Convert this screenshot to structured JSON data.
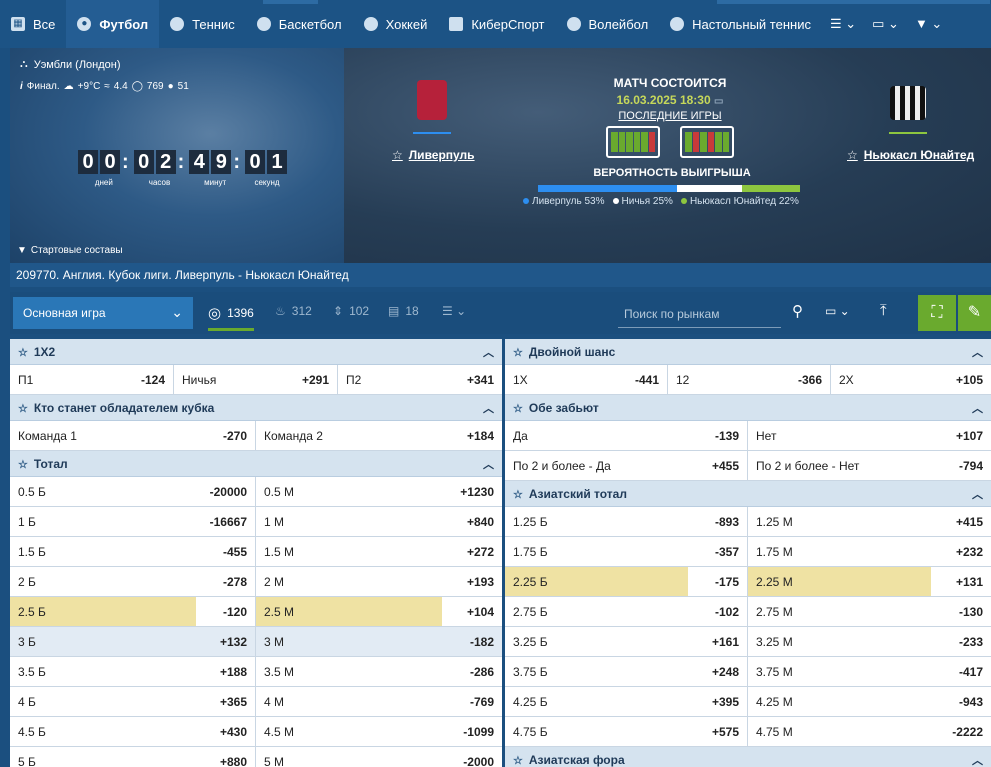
{
  "nav": {
    "items": [
      {
        "label": "Все",
        "icon": "grid-icon"
      },
      {
        "label": "Футбол",
        "icon": "football-icon"
      },
      {
        "label": "Теннис",
        "icon": "tennis-icon"
      },
      {
        "label": "Баскетбол",
        "icon": "basketball-icon"
      },
      {
        "label": "Хоккей",
        "icon": "hockey-icon"
      },
      {
        "label": "КиберСпорт",
        "icon": "gamepad-icon"
      },
      {
        "label": "Волейбол",
        "icon": "volleyball-icon"
      },
      {
        "label": "Настольный теннис",
        "icon": "table-tennis-icon"
      }
    ]
  },
  "hero": {
    "venue": "Уэмбли (Лондон)",
    "weather": {
      "status": "Финал.",
      "temp": "+9°C",
      "wind": "4.4",
      "pressure": "769",
      "humidity": "51"
    },
    "countdown": {
      "days": [
        "0",
        "0"
      ],
      "hours": [
        "0",
        "2"
      ],
      "minutes": [
        "4",
        "9"
      ],
      "seconds": [
        "0",
        "1"
      ],
      "labels": {
        "days": "дней",
        "hours": "часов",
        "minutes": "минут",
        "seconds": "секунд"
      }
    },
    "lineups": "Стартовые составы",
    "team1": "Ливерпуль",
    "team2": "Ньюкасл Юнайтед",
    "status": "МАТЧ СОСТОИТСЯ",
    "date": "16.03.2025 18:30",
    "last_games": "ПОСЛЕДНИЕ ИГРЫ",
    "form1": [
      "#6aaa2e",
      "#6aaa2e",
      "#6aaa2e",
      "#6aaa2e",
      "#6aaa2e",
      "#c83a3a"
    ],
    "form2": [
      "#6aaa2e",
      "#c83a3a",
      "#6aaa2e",
      "#c83a3a",
      "#6aaa2e",
      "#6aaa2e"
    ],
    "prob_title": "ВЕРОЯТНОСТЬ ВЫИГРЫША",
    "prob": [
      {
        "label": "Ливерпуль 53%",
        "value": 53,
        "color": "#2d8ef0"
      },
      {
        "label": "Ничья 25%",
        "value": 25,
        "color": "#ffffff"
      },
      {
        "label": "Ньюкасл Юнайтед 22%",
        "value": 22,
        "color": "#8dc63f"
      }
    ]
  },
  "event": "209770. Англия. Кубок лиги. Ливерпуль - Ньюкасл Юнайтед",
  "toolbar": {
    "main_select": "Основная игра",
    "counts": [
      {
        "value": "1396",
        "icon": "target-icon"
      },
      {
        "value": "312",
        "icon": "fire-icon"
      },
      {
        "value": "102",
        "icon": "updown-icon"
      },
      {
        "value": "18",
        "icon": "stats-icon"
      }
    ],
    "search_placeholder": "Поиск по рынкам"
  },
  "markets": {
    "m1x2": {
      "title": "1X2",
      "row": [
        [
          "П1",
          "-124"
        ],
        [
          "Ничья",
          "+291"
        ],
        [
          "П2",
          "+341"
        ]
      ]
    },
    "double": {
      "title": "Двойной шанс",
      "row": [
        [
          "1X",
          "-441"
        ],
        [
          "12",
          "-366"
        ],
        [
          "2X",
          "+105"
        ]
      ]
    },
    "cup": {
      "title": "Кто станет обладателем кубка",
      "row": [
        [
          "Команда 1",
          "-270"
        ],
        [
          "Команда 2",
          "+184"
        ]
      ]
    },
    "both": {
      "title": "Обе забьют",
      "rows": [
        [
          [
            "Да",
            "-139"
          ],
          [
            "Нет",
            "+107"
          ]
        ],
        [
          [
            "По 2 и более - Да",
            "+455"
          ],
          [
            "По 2 и более - Нет",
            "-794"
          ]
        ]
      ]
    },
    "total": {
      "title": "Тотал",
      "rows": [
        [
          [
            "0.5 Б",
            "-20000"
          ],
          [
            "0.5 М",
            "+1230"
          ]
        ],
        [
          [
            "1 Б",
            "-16667"
          ],
          [
            "1 М",
            "+840"
          ]
        ],
        [
          [
            "1.5 Б",
            "-455"
          ],
          [
            "1.5 М",
            "+272"
          ]
        ],
        [
          [
            "2 Б",
            "-278"
          ],
          [
            "2 М",
            "+193"
          ]
        ],
        [
          [
            "2.5 Б",
            "-120"
          ],
          [
            "2.5 М",
            "+104"
          ]
        ],
        [
          [
            "3 Б",
            "+132"
          ],
          [
            "3 М",
            "-182"
          ]
        ],
        [
          [
            "3.5 Б",
            "+188"
          ],
          [
            "3.5 М",
            "-286"
          ]
        ],
        [
          [
            "4 Б",
            "+365"
          ],
          [
            "4 М",
            "-769"
          ]
        ],
        [
          [
            "4.5 Б",
            "+430"
          ],
          [
            "4.5 М",
            "-1099"
          ]
        ],
        [
          [
            "5 Б",
            "+880"
          ],
          [
            "5 М",
            "-2000"
          ]
        ]
      ]
    },
    "asian_total": {
      "title": "Азиатский тотал",
      "rows": [
        [
          [
            "1.25 Б",
            "-893"
          ],
          [
            "1.25 М",
            "+415"
          ]
        ],
        [
          [
            "1.75 Б",
            "-357"
          ],
          [
            "1.75 М",
            "+232"
          ]
        ],
        [
          [
            "2.25 Б",
            "-175"
          ],
          [
            "2.25 М",
            "+131"
          ]
        ],
        [
          [
            "2.75 Б",
            "-102"
          ],
          [
            "2.75 М",
            "-130"
          ]
        ],
        [
          [
            "3.25 Б",
            "+161"
          ],
          [
            "3.25 М",
            "-233"
          ]
        ],
        [
          [
            "3.75 Б",
            "+248"
          ],
          [
            "3.75 М",
            "-417"
          ]
        ],
        [
          [
            "4.25 Б",
            "+395"
          ],
          [
            "4.25 М",
            "-943"
          ]
        ],
        [
          [
            "4.75 Б",
            "+575"
          ],
          [
            "4.75 М",
            "-2222"
          ]
        ]
      ]
    },
    "asian_handicap": {
      "title": "Азиатская фора"
    }
  }
}
